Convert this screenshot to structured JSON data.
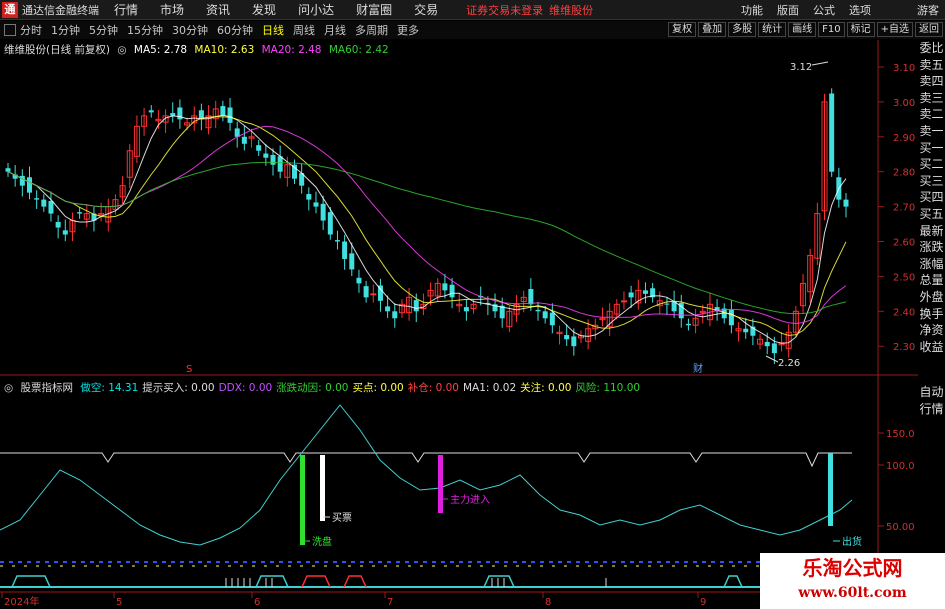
{
  "titlebar": {
    "app_title": "通达信金融终端",
    "menu": [
      "行情",
      "市场",
      "资讯",
      "发现",
      "问小达",
      "财富圈",
      "交易"
    ],
    "notice": "证券交易未登录",
    "notice2": "维维股份",
    "right": [
      "功能",
      "版面",
      "公式",
      "选项"
    ],
    "guest": "游客"
  },
  "toolbar": {
    "periods": [
      "分时",
      "1分钟",
      "5分钟",
      "15分钟",
      "30分钟",
      "60分钟",
      "日线",
      "周线",
      "月线",
      "多周期",
      "更多"
    ],
    "active_period": "日线",
    "right_buttons": [
      "复权",
      "叠加",
      "多股",
      "统计",
      "画线",
      "F10",
      "标记",
      "+自选",
      "返回"
    ]
  },
  "stock_info": {
    "name": "维维股份(日线 前复权)",
    "ma5": "MA5: 2.78",
    "ma10": "MA10: 2.63",
    "ma20": "MA20: 2.48",
    "ma60": "MA60: 2.42"
  },
  "indicator_info": {
    "name": "股票指标网",
    "items": [
      {
        "label": "做空: 14.31",
        "color": "#00e5e5"
      },
      {
        "label": "提示买入: 0.00",
        "color": "#dddddd"
      },
      {
        "label": "DDX: 0.00",
        "color": "#c050ff"
      },
      {
        "label": "涨跌动因: 0.00",
        "color": "#30d030"
      },
      {
        "label": "买点: 0.00",
        "color": "#ffff40"
      },
      {
        "label": "补仓: 0.00",
        "color": "#ff4040"
      },
      {
        "label": "MA1: 0.02",
        "color": "#dddddd"
      },
      {
        "label": "关注: 0.00",
        "color": "#ffff40"
      },
      {
        "label": "风险: 110.00",
        "color": "#30d030"
      }
    ]
  },
  "price_axis": [
    "3.10",
    "3.00",
    "2.90",
    "2.80",
    "2.70",
    "2.60",
    "2.50",
    "2.40",
    "2.30"
  ],
  "ind_axis": [
    "150.0",
    "100.0",
    "50.00"
  ],
  "date_axis": [
    "2024年",
    "5",
    "6",
    "7",
    "8",
    "9"
  ],
  "annotations": {
    "high": "3.12",
    "low": "2.26",
    "cai": "财",
    "s": "S",
    "xipan": "洗盘",
    "maipiao": "买票",
    "zhuli": "主力进入",
    "chuxi": "出货"
  },
  "right_panel": [
    "委比",
    "卖五",
    "卖四",
    "卖三",
    "卖二",
    "卖一",
    "买一",
    "买二",
    "买三",
    "买四",
    "买五",
    "最新",
    "涨跌",
    "涨幅",
    "总量",
    "外盘",
    "换手",
    "净资",
    "收益"
  ],
  "right_panel2": [
    "自动",
    "行情"
  ],
  "watermark": {
    "line1": "乐淘公式网",
    "line2": "www.60lt.com"
  }
}
